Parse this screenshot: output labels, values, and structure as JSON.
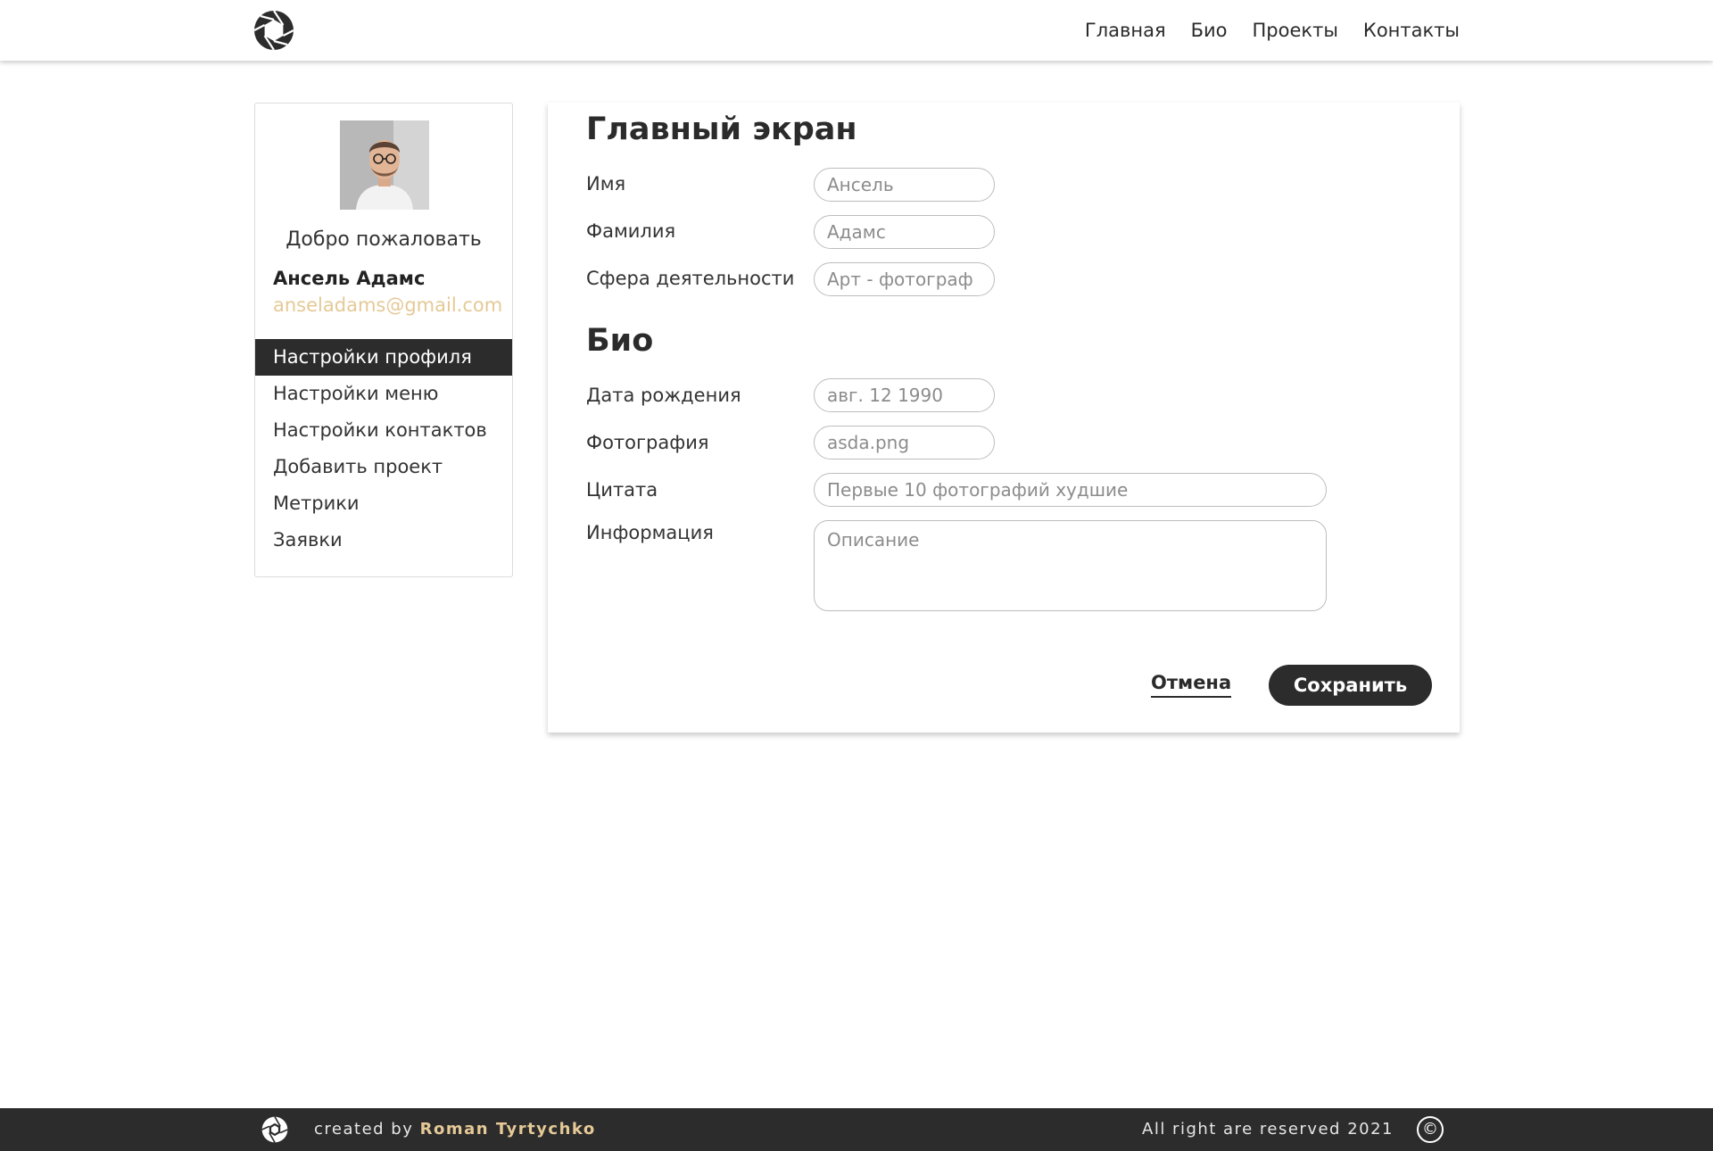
{
  "header": {
    "logo_icon": "aperture-logo-icon",
    "nav": [
      "Главная",
      "Био",
      "Проекты",
      "Контакты"
    ]
  },
  "sidebar": {
    "welcome": "Добро пожаловать",
    "user_name": "Ансель Адамс",
    "user_email": "anseladams@gmail.com",
    "menu": [
      "Настройки профиля",
      "Настройки меню",
      "Настройки контактов",
      "Добавить проект",
      "Метрики",
      "Заявки"
    ],
    "active_index": 0
  },
  "main_section": {
    "title": "Главный экран",
    "fields": [
      {
        "label": "Имя",
        "placeholder": "Ансель"
      },
      {
        "label": "Фамилия",
        "placeholder": "Адамс"
      },
      {
        "label": "Сфера деятельности",
        "placeholder": "Арт - фотограф"
      }
    ]
  },
  "bio_section": {
    "title": "Био",
    "fields": [
      {
        "label": "Дата рождения",
        "placeholder": "авг. 12 1990"
      },
      {
        "label": "Фотография",
        "placeholder": "asda.png"
      },
      {
        "label": "Цитата",
        "placeholder": "Первые 10 фотографий худшие"
      },
      {
        "label": "Информация",
        "placeholder": "Описание"
      }
    ]
  },
  "actions": {
    "cancel": "Отмена",
    "save": "Сохранить"
  },
  "footer": {
    "created_by": "created by",
    "author": "Roman Tyrtychko",
    "rights": "All right are reserved 2021",
    "copyright_symbol": "©"
  },
  "colors": {
    "accent": "#e5c996",
    "dark": "#2c2c2c"
  }
}
